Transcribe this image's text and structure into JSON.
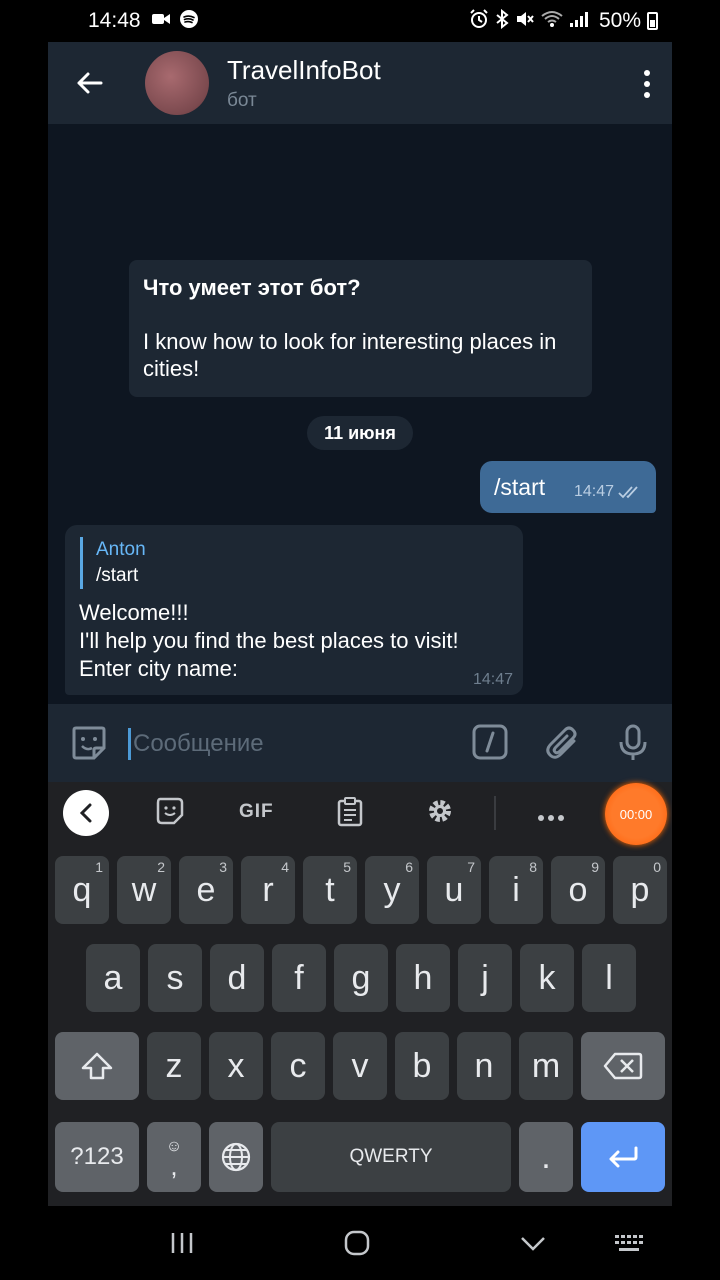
{
  "status_bar": {
    "time": "14:48",
    "battery_pct": "50%",
    "left_icons": [
      "video-icon",
      "spotify-icon"
    ],
    "right_icons": [
      "alarm-icon",
      "bluetooth-icon",
      "mute-icon",
      "wifi-icon",
      "signal-icon",
      "battery-icon"
    ]
  },
  "header": {
    "title": "TravelInfoBot",
    "subtitle": "бот"
  },
  "chat": {
    "intro": {
      "question": "Что умеет этот бот?",
      "text": "I know how to look for interesting places in cities!"
    },
    "date_label": "11 июня",
    "messages": [
      {
        "direction": "out",
        "text": "/start",
        "time": "14:47",
        "status": "read"
      },
      {
        "direction": "in",
        "reply_to": {
          "name": "Anton",
          "text": "/start"
        },
        "lines": [
          "Welcome!!!",
          "I'll help you find the best places to visit!",
          "Enter city name:"
        ],
        "time": "14:47"
      }
    ]
  },
  "input": {
    "placeholder": "Сообщение"
  },
  "keyboard": {
    "toolbar": {
      "gif_label": "GIF",
      "record_time": "00:00"
    },
    "row1": [
      {
        "k": "q",
        "n": "1"
      },
      {
        "k": "w",
        "n": "2"
      },
      {
        "k": "e",
        "n": "3"
      },
      {
        "k": "r",
        "n": "4"
      },
      {
        "k": "t",
        "n": "5"
      },
      {
        "k": "y",
        "n": "6"
      },
      {
        "k": "u",
        "n": "7"
      },
      {
        "k": "i",
        "n": "8"
      },
      {
        "k": "o",
        "n": "9"
      },
      {
        "k": "p",
        "n": "0"
      }
    ],
    "row2": [
      "a",
      "s",
      "d",
      "f",
      "g",
      "h",
      "j",
      "k",
      "l"
    ],
    "row3": [
      "z",
      "x",
      "c",
      "v",
      "b",
      "n",
      "m"
    ],
    "symbols_label": "?123",
    "comma_label": ",",
    "space_label": "QWERTY",
    "period_label": "."
  },
  "colors": {
    "chat_bg": "#0e1621",
    "bubble_in": "#1d2733",
    "bubble_out": "#3e6a96",
    "accent": "#5aa8e4",
    "key_bg": "#3c4043",
    "enter_key": "#5e97f6",
    "record_button": "#ff6a00"
  }
}
